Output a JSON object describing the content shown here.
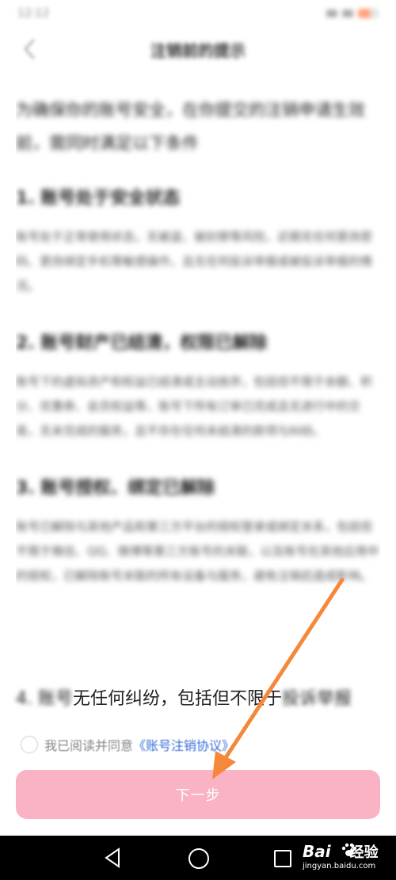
{
  "status_bar": {
    "time": "12:12"
  },
  "header": {
    "back_icon": "chevron-left-icon",
    "title": "注销前的提示"
  },
  "content": {
    "intro": "为确保你的账号安全，在你提交的注销申请生效前，需同时满足以下条件",
    "sections": [
      {
        "title": "1. 账号处于安全状态",
        "body": "账号处于正常使用状态，无被盗、被封禁等风险，近期无任何更改密码、更改绑定手机等敏感操作，且无任何投诉举报或被投诉举报的情况。"
      },
      {
        "title": "2. 账号财产已结清，权限已解除",
        "body": "账号下的虚拟资产和权益已结清或主动放弃，包括但不限于余额、积分、优惠券、会员权益等，账号下所有订单已完成且无进行中的交易，无未完成的服务，且不存在任何未结清的款项与纠纷。"
      },
      {
        "title": "3. 账号授权、绑定已解除",
        "body": "账号已解除与其他产品和第三方平台的授权登录或绑定关系，包括但不限于微信、QQ、微博等第三方账号的关联，以及账号在其他应用中的授权，已解除账号关联的所有设备与服务，避免注销后造成影响。"
      }
    ],
    "section4_prefix": "4. 账号",
    "section4_visible": "无任何纠纷，包括但不限于",
    "section4_tail": "投诉举报"
  },
  "agreement": {
    "prefix": "我已阅读并同意",
    "link": "《账号注销协议》"
  },
  "next_button": {
    "label": "下一步"
  },
  "watermark": {
    "main": "Bai",
    "main_after": "经验",
    "sub": "jingyan.baidu.com"
  },
  "colors": {
    "button": "#f9b3c4",
    "link": "#3a6fd8",
    "annotation_arrow": "#f5883a"
  }
}
